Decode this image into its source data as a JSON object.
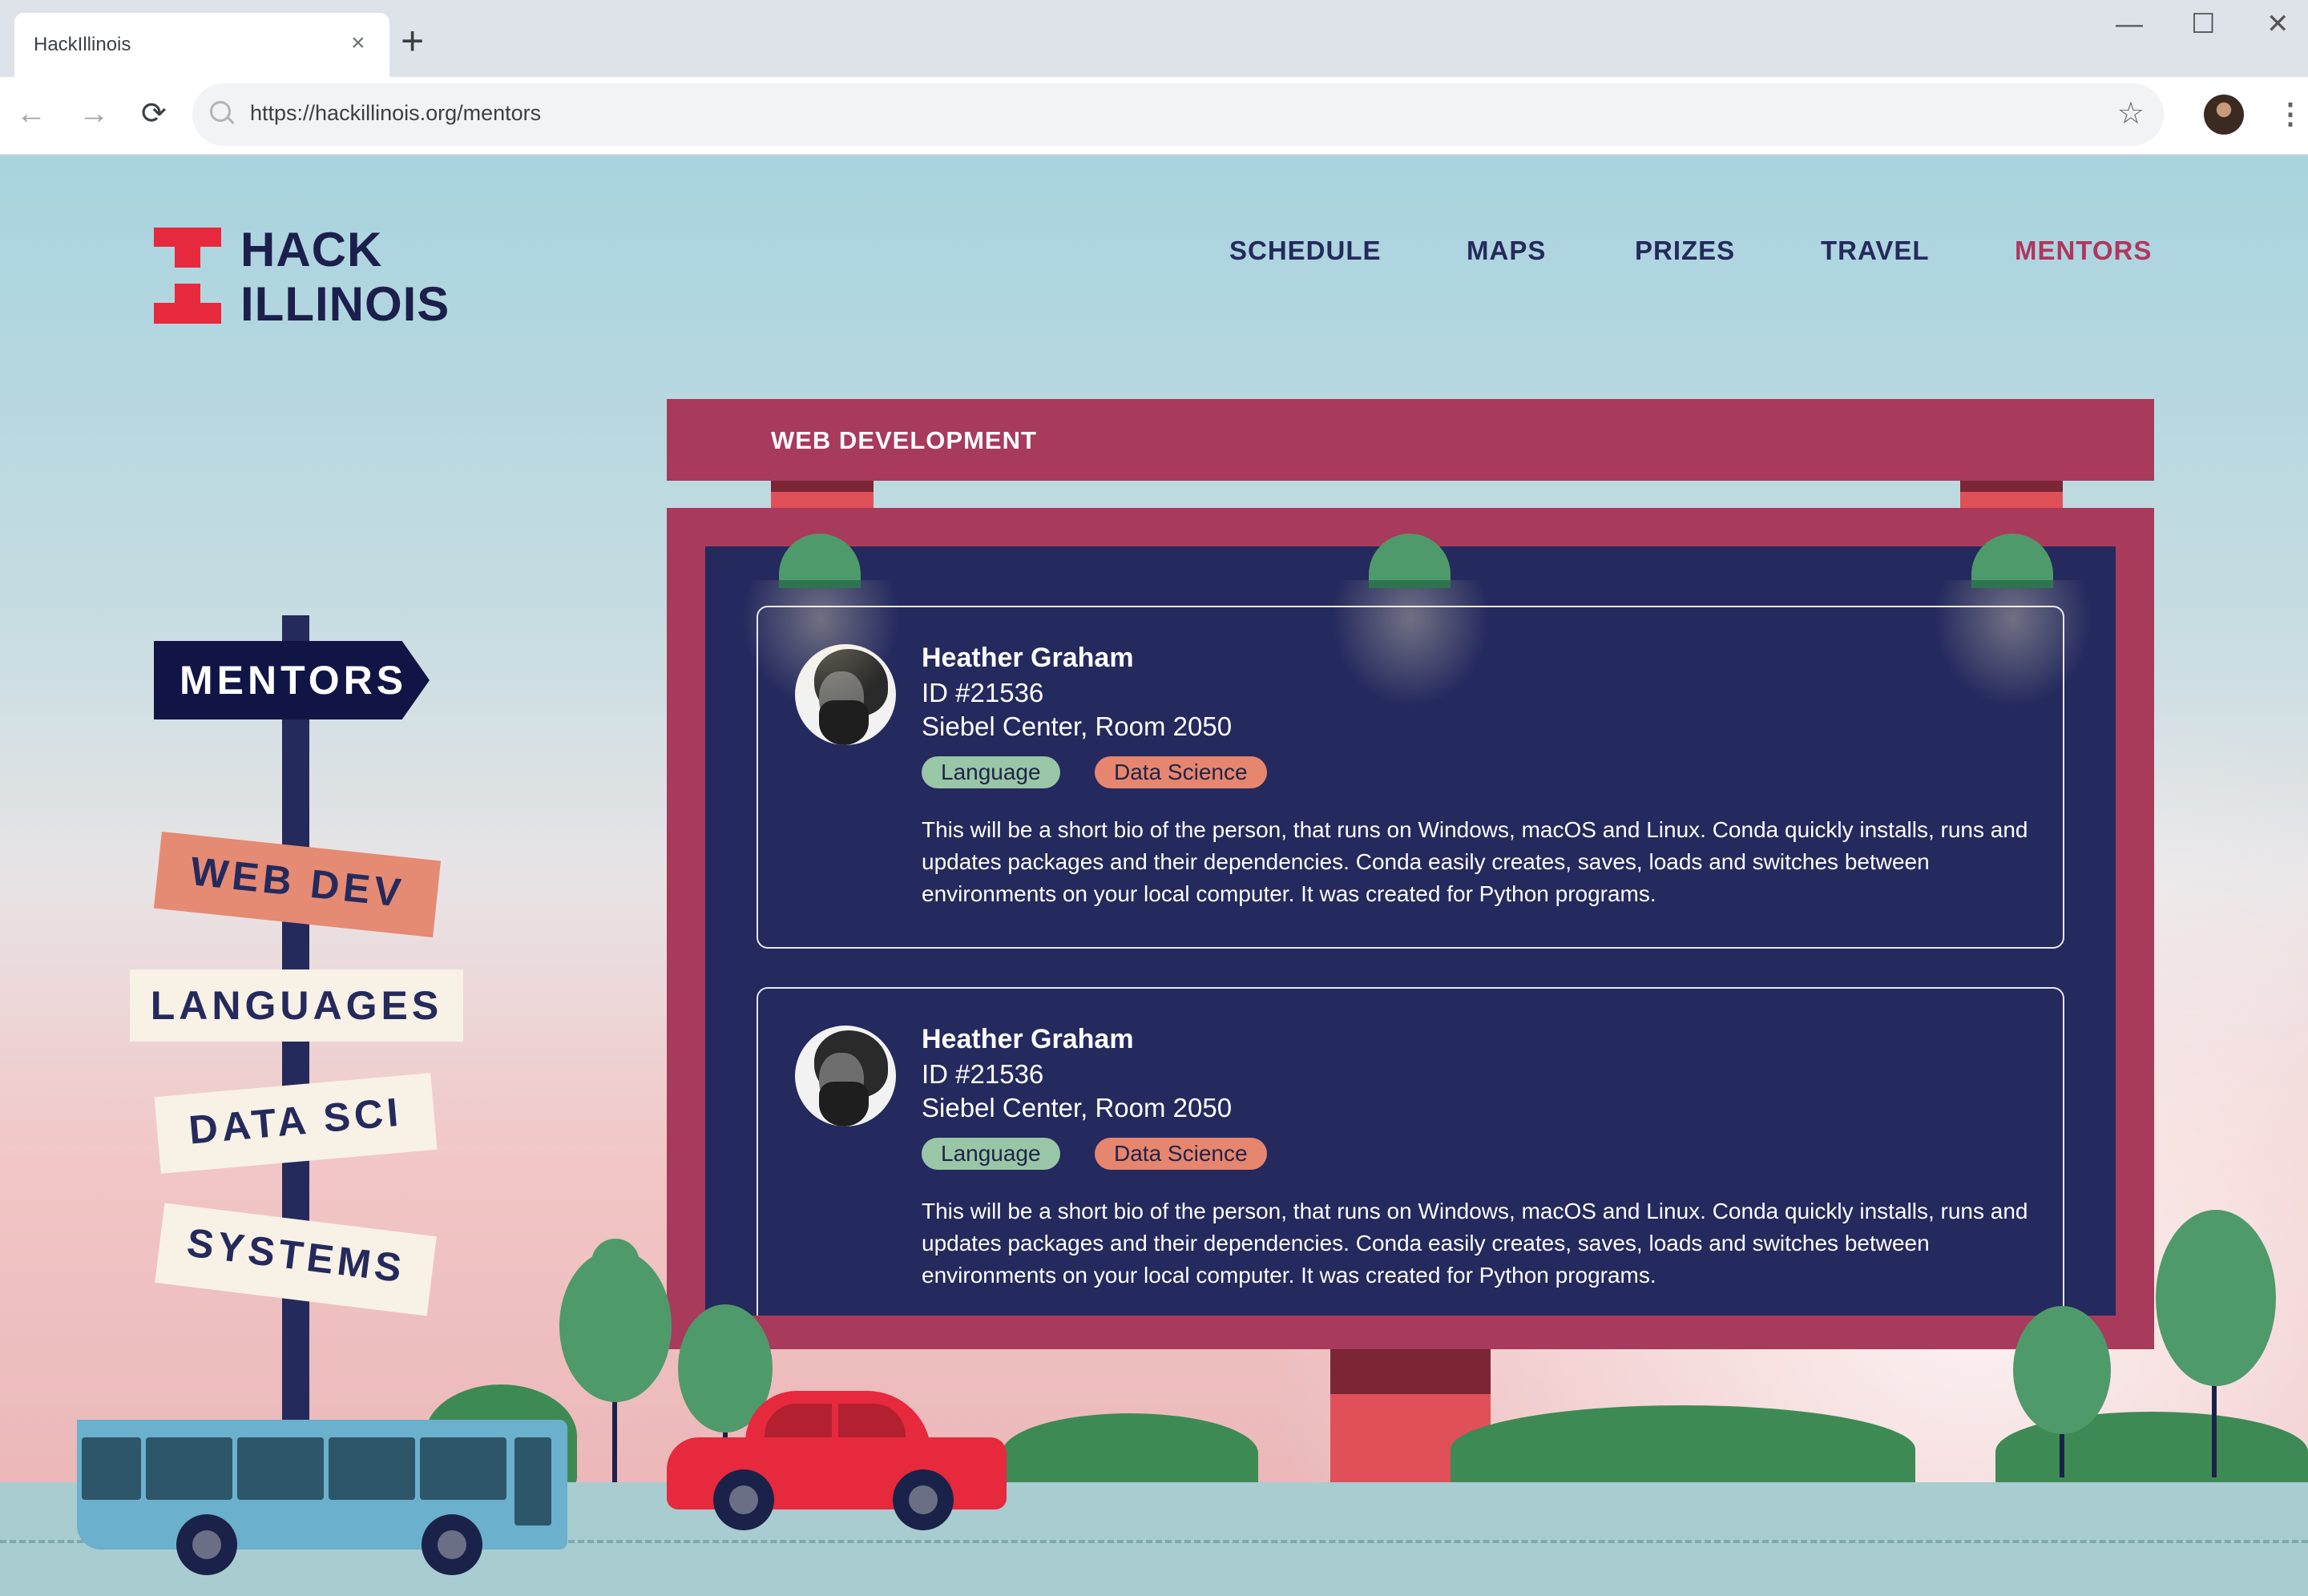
{
  "browser": {
    "tab_title": "HackIllinois",
    "tab_close": "×",
    "new_tab": "+",
    "url": "https://hackillinois.org/mentors",
    "back": "←",
    "forward": "→",
    "reload": "⟳",
    "star": "☆",
    "menu": "⋮",
    "minimize": "—",
    "maximize": "☐",
    "close": "✕"
  },
  "logo": {
    "line1": "HACK",
    "line2": "ILLINOIS"
  },
  "nav": [
    {
      "label": "SCHEDULE",
      "active": false
    },
    {
      "label": "MAPS",
      "active": false
    },
    {
      "label": "PRIZES",
      "active": false
    },
    {
      "label": "TRAVEL",
      "active": false
    },
    {
      "label": "MENTORS",
      "active": true
    }
  ],
  "signpost": {
    "title": "MENTORS",
    "items": [
      "WEB DEV",
      "LANGUAGES",
      "DATA SCI",
      "SYSTEMS"
    ]
  },
  "billboard": {
    "title": "WEB DEVELOPMENT"
  },
  "mentors": [
    {
      "name": "Heather Graham",
      "id": "ID #21536",
      "location": "Siebel Center, Room 2050",
      "tags": [
        "Language",
        "Data Science"
      ],
      "bio": "This will be a short bio of the person, that runs on Windows, macOS and Linux. Conda quickly installs, runs and updates packages and their dependencies. Conda easily creates, saves, loads and switches between environments on your local computer. It was created for Python programs."
    },
    {
      "name": "Heather Graham",
      "id": "ID #21536",
      "location": "Siebel Center, Room 2050",
      "tags": [
        "Language",
        "Data Science"
      ],
      "bio": "This will be a short bio of the person, that runs on Windows, macOS and Linux. Conda quickly installs, runs and updates packages and their dependencies. Conda easily creates, saves, loads and switches between environments on your local computer. It was created for Python programs."
    }
  ],
  "colors": {
    "brand_red": "#e6293c",
    "navy": "#252a5c",
    "billboard": "#a83a5b",
    "board": "#24295e",
    "active_nav": "#b0365e"
  }
}
